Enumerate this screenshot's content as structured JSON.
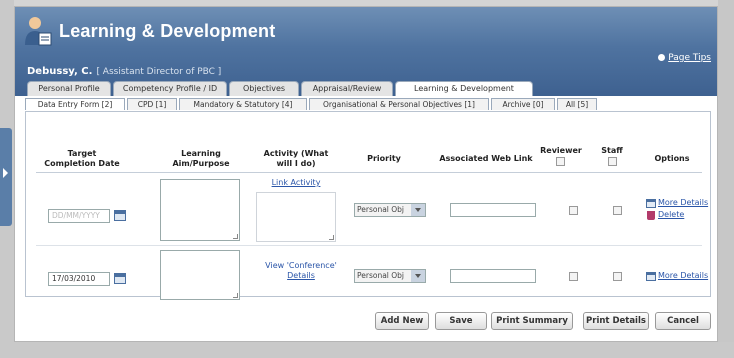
{
  "app": {
    "title": "Learning & Development",
    "page_tips": "Page Tips"
  },
  "user": {
    "name": "Debussy, C.",
    "role": "[ Assistant Director of PBC ]"
  },
  "tabs": [
    "Personal Profile",
    "Competency Profile / ID",
    "Objectives",
    "Appraisal/Review",
    "Learning & Development"
  ],
  "subtabs": [
    "Data Entry Form [2]",
    "CPD [1]",
    "Mandatory & Statutory [4]",
    "Organisational & Personal Objectives [1]",
    "Archive [0]",
    "All [5]"
  ],
  "columns": {
    "target_date": "Target Completion Date",
    "aim": "Learning Aim/Purpose",
    "activity": "Activity (What will I do)",
    "priority": "Priority",
    "weblink": "Associated Web Link",
    "reviewer": "Reviewer",
    "staff": "Staff",
    "options": "Options"
  },
  "rows": [
    {
      "date_placeholder": "DD/MM/YYYY",
      "date_value": "",
      "activity_link": "Link Activity",
      "activity_link2": "",
      "priority": "Personal Obj",
      "options": [
        "More Details",
        "Delete"
      ]
    },
    {
      "date_placeholder": "",
      "date_value": "17/03/2010",
      "activity_link": "View 'Conference'",
      "activity_link2": "Details",
      "priority": "Personal Obj",
      "options": [
        "More Details"
      ]
    }
  ],
  "buttons": {
    "add_new": "Add New",
    "save": "Save",
    "print_summary": "Print Summary",
    "print_details": "Print Details",
    "cancel": "Cancel"
  },
  "colors": {
    "header": "#4f73a0",
    "link": "#2a55a8"
  }
}
